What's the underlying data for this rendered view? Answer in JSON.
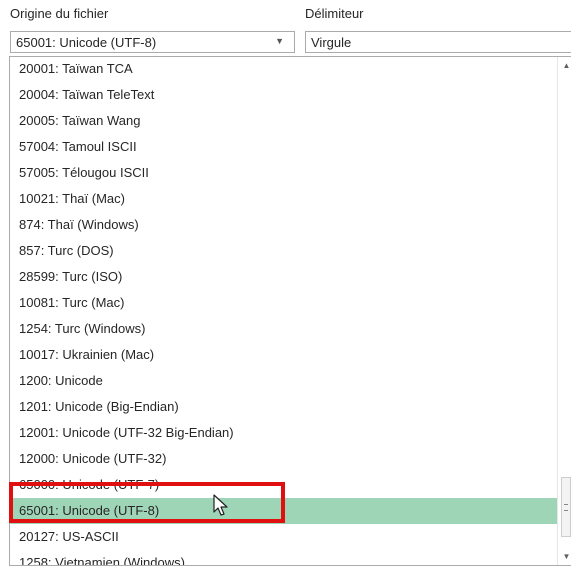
{
  "origin": {
    "label": "Origine du fichier",
    "value": "65001: Unicode (UTF-8)"
  },
  "delimiter": {
    "label": "Délimiteur",
    "value": "Virgule"
  },
  "dropdown": {
    "items": [
      "20001: Taïwan TCA",
      "20004: Taïwan TeleText",
      "20005: Taïwan Wang",
      "57004: Tamoul ISCII",
      "57005: Télougou ISCII",
      "10021: Thaï (Mac)",
      "874: Thaï (Windows)",
      "857: Turc (DOS)",
      "28599: Turc (ISO)",
      "10081: Turc (Mac)",
      "1254: Turc (Windows)",
      "10017: Ukrainien (Mac)",
      "1200: Unicode",
      "1201: Unicode (Big-Endian)",
      "12001: Unicode (UTF-32 Big-Endian)",
      "12000: Unicode (UTF-32)",
      "65000: Unicode (UTF-7)",
      "65001: Unicode (UTF-8)",
      "20127: US-ASCII",
      "1258: Vietnamien (Windows)"
    ],
    "selected": "65001: Unicode (UTF-8)"
  },
  "colors": {
    "selection": "#9fd5b7",
    "highlight_box": "#e01010"
  },
  "icons": {
    "combo_arrow": "chevron-down-icon",
    "scroll_up": "scroll-up-arrow-icon",
    "scroll_down": "scroll-down-arrow-icon",
    "cursor": "mouse-pointer-icon"
  }
}
